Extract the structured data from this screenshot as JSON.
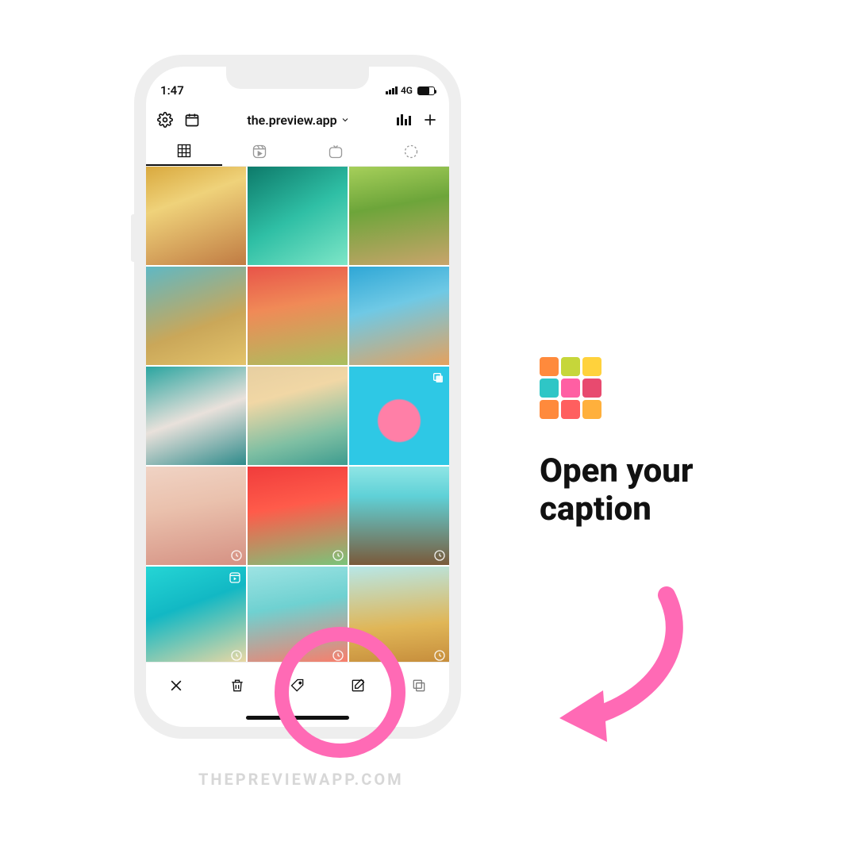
{
  "status": {
    "time": "1:47",
    "network": "4G"
  },
  "nav": {
    "username": "the.preview.app"
  },
  "logo_colors": [
    "#ff8a3c",
    "#c6d63a",
    "#ffd23c",
    "#2fc6c6",
    "#ff5fa3",
    "#e84a6f",
    "#ff8a3c",
    "#ff5f5f",
    "#ffb03c"
  ],
  "panel": {
    "heading_line1": "Open your",
    "heading_line2": "caption"
  },
  "arrow_color": "#ff6ab5",
  "watermark": "THEPREVIEWAPP.COM",
  "icons": {
    "settings": "settings-icon",
    "calendar": "calendar-icon",
    "analytics": "analytics-icon",
    "plus": "plus-icon",
    "grid_tab": "grid-tab-icon",
    "reels_tab": "reels-tab-icon",
    "igtv_tab": "igtv-tab-icon",
    "story_tab": "story-tab-icon",
    "close": "close-icon",
    "trash": "trash-icon",
    "tag": "tag-icon",
    "compose": "compose-icon",
    "copy": "copy-icon"
  }
}
